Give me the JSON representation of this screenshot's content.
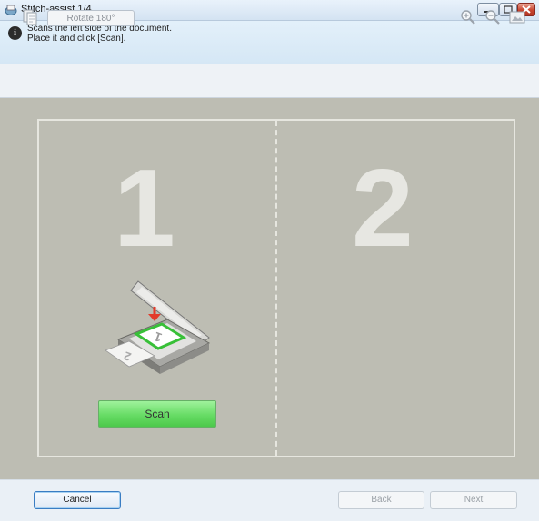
{
  "window": {
    "title": "Stitch-assist 1/4"
  },
  "info": {
    "line1": "Scans the left side of the document.",
    "line2": "Place it and click [Scan]."
  },
  "toolbar": {
    "rotate_label": "Rotate 180°",
    "icons": [
      "page-rotate-icon",
      "zoom-in-icon",
      "zoom-out-icon",
      "fit-to-window-icon"
    ]
  },
  "canvas": {
    "left_number": "1",
    "right_number": "2",
    "scan_label": "Scan"
  },
  "footer": {
    "cancel_label": "Cancel",
    "back_label": "Back",
    "next_label": "Next"
  },
  "colors": {
    "canvas_background": "#bdbdb3",
    "scan_button": "#67dc65",
    "close_button": "#c9452f"
  }
}
